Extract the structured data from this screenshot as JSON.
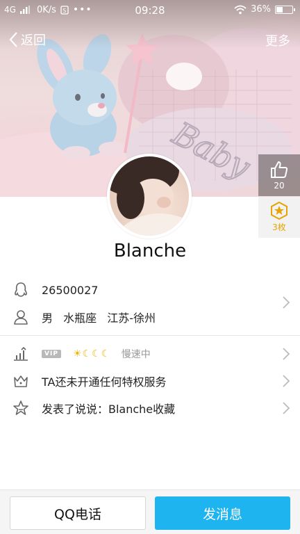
{
  "status_bar": {
    "network": "4G",
    "speed": "0K/s",
    "time": "09:28",
    "battery": "36%",
    "battery_level": 0.36
  },
  "nav": {
    "back_label": "返回",
    "more_label": "更多"
  },
  "cover": {
    "pillow_text": "Baby"
  },
  "stats": {
    "likes": "20",
    "medals": "3枚"
  },
  "profile": {
    "nickname": "Blanche",
    "qq_number": "26500027",
    "gender": "男",
    "zodiac": "水瓶座",
    "location": "江苏-徐州"
  },
  "privileges": {
    "vip_tag": "VIP",
    "level_icons": [
      "sun",
      "moon",
      "moon",
      "moon"
    ],
    "speed_text": "慢速中",
    "service_text": "TA还未开通任何特权服务",
    "feed_text": "发表了说说：Blanche收藏"
  },
  "actions": {
    "call_label": "QQ电话",
    "message_label": "发消息"
  },
  "colors": {
    "accent": "#1db4ef",
    "medal": "#e6a400",
    "level": "#f0b400"
  }
}
